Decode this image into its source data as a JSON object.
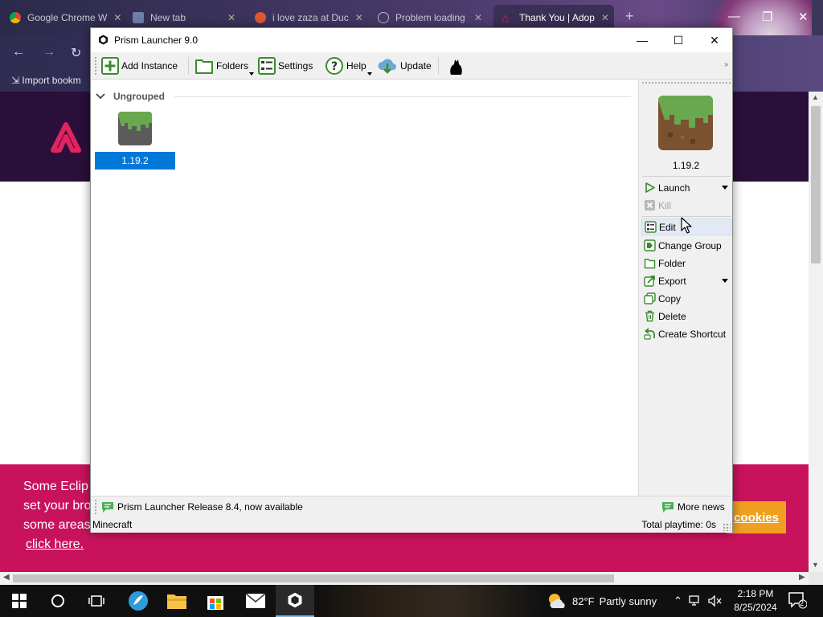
{
  "browser": {
    "tabs": [
      {
        "title": "Google Chrome W",
        "fav_color": "#db4437"
      },
      {
        "title": "New tab",
        "fav_color": "#8ab4f8"
      },
      {
        "title": "i love zaza at Duc",
        "fav_color": "#de5833"
      },
      {
        "title": "Problem loading",
        "fav_color": "#9a9a9a"
      },
      {
        "title": "Thank You | Adop",
        "fav_color": "#e0245e"
      }
    ],
    "bookmark": "Import bookm",
    "cookie_text_lines": [
      "Some Eclip",
      "set your bro",
      "some areas"
    ],
    "cookie_link": "click here.",
    "cookie_button": "cookies"
  },
  "launcher": {
    "title": "Prism Launcher 9.0",
    "toolbar": {
      "add_instance": "Add Instance",
      "folders": "Folders",
      "settings": "Settings",
      "help": "Help",
      "update": "Update"
    },
    "group": {
      "name": "Ungrouped"
    },
    "instances": [
      {
        "name": "1.19.2"
      }
    ],
    "sidebar": {
      "instance_name": "1.19.2",
      "actions": [
        {
          "label": "Launch",
          "has_menu": true,
          "enabled": true
        },
        {
          "label": "Kill",
          "has_menu": false,
          "enabled": false
        },
        {
          "label": "Edit",
          "has_menu": false,
          "enabled": true
        },
        {
          "label": "Change Group",
          "has_menu": false,
          "enabled": true
        },
        {
          "label": "Folder",
          "has_menu": false,
          "enabled": true
        },
        {
          "label": "Export",
          "has_menu": true,
          "enabled": true
        },
        {
          "label": "Copy",
          "has_menu": false,
          "enabled": true
        },
        {
          "label": "Delete",
          "has_menu": false,
          "enabled": true
        },
        {
          "label": "Create Shortcut",
          "has_menu": false,
          "enabled": true
        }
      ]
    },
    "news": {
      "headline": "Prism Launcher Release 8.4, now available",
      "more": "More news"
    },
    "status": {
      "left": "Minecraft",
      "right": "Total playtime: 0s"
    }
  },
  "taskbar": {
    "weather_temp": "82°F",
    "weather_desc": "Partly sunny",
    "time": "2:18 PM",
    "date": "8/25/2024",
    "notification_count": "2"
  },
  "colors": {
    "selection": "#0078d7",
    "cookie_bar": "#c8135c",
    "grass_green": "#6aa84f",
    "dirt_brown": "#7a5230"
  }
}
